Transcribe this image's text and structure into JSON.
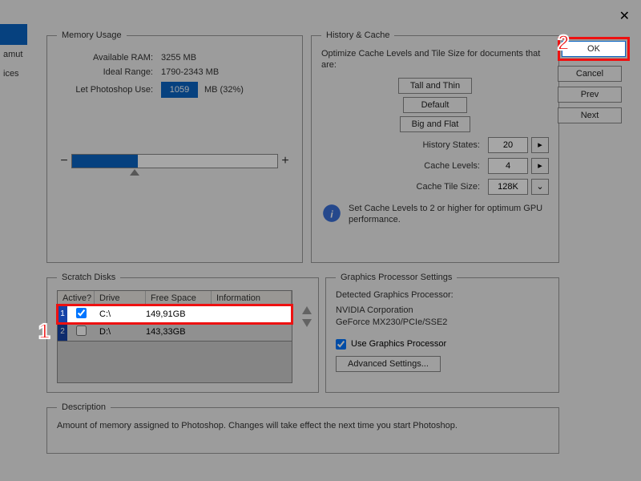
{
  "sidebar": {
    "partial1": "amut",
    "partial2": "ices"
  },
  "memory": {
    "legend": "Memory Usage",
    "available_label": "Available RAM:",
    "available_value": "3255 MB",
    "ideal_label": "Ideal Range:",
    "ideal_value": "1790-2343 MB",
    "use_label": "Let Photoshop Use:",
    "use_value": "1059",
    "use_suffix": "MB (32%)"
  },
  "history": {
    "legend": "History & Cache",
    "desc": "Optimize Cache Levels and Tile Size for documents that are:",
    "tall": "Tall and Thin",
    "default": "Default",
    "big": "Big and Flat",
    "states_label": "History States:",
    "states_value": "20",
    "levels_label": "Cache Levels:",
    "levels_value": "4",
    "tile_label": "Cache Tile Size:",
    "tile_value": "128K",
    "tip": "Set Cache Levels to 2 or higher for optimum GPU performance."
  },
  "scratch": {
    "legend": "Scratch Disks",
    "cols": {
      "active": "Active?",
      "drive": "Drive",
      "free": "Free Space",
      "info": "Information"
    },
    "rows": [
      {
        "num": "1",
        "checked": true,
        "drive": "C:\\",
        "free": "149,91GB"
      },
      {
        "num": "2",
        "checked": false,
        "drive": "D:\\",
        "free": "143,33GB"
      }
    ]
  },
  "gfx": {
    "legend": "Graphics Processor Settings",
    "detected_label": "Detected Graphics Processor:",
    "vendor": "NVIDIA Corporation",
    "device": "GeForce MX230/PCIe/SSE2",
    "use_label": "Use Graphics Processor",
    "adv": "Advanced Settings..."
  },
  "desc": {
    "legend": "Description",
    "text": "Amount of memory assigned to Photoshop. Changes will take effect the next time you start Photoshop."
  },
  "buttons": {
    "ok": "OK",
    "cancel": "Cancel",
    "prev": "Prev",
    "next": "Next"
  },
  "callouts": {
    "one": "1",
    "two": "2"
  }
}
